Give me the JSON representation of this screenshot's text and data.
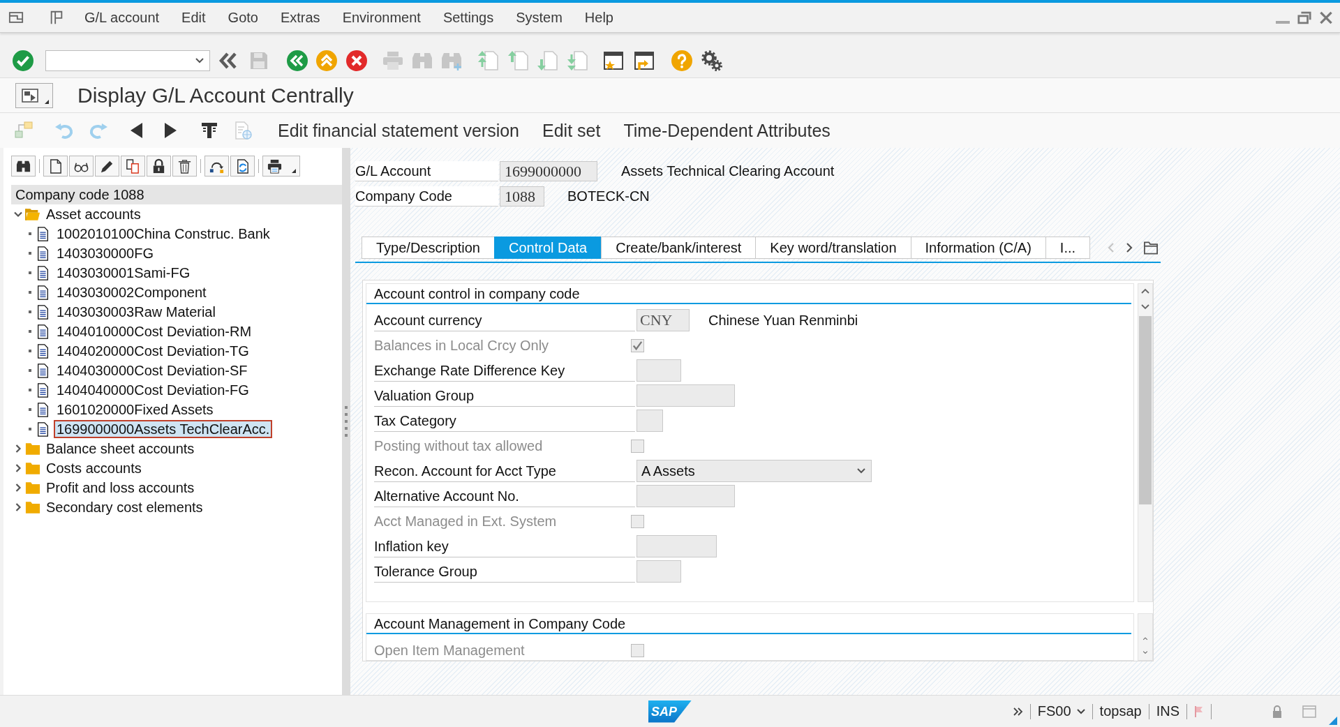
{
  "menu_bar": {
    "items": [
      "G/L account",
      "Edit",
      "Goto",
      "Extras",
      "Environment",
      "Settings",
      "System",
      "Help"
    ]
  },
  "title": "Display G/L Account Centrally",
  "app_toolbar": {
    "buttons": [
      "Edit financial statement version",
      "Edit set",
      "Time-Dependent Attributes"
    ]
  },
  "tree": {
    "header": "Company code 1088",
    "items": [
      {
        "label": "Asset accounts",
        "expanded": true,
        "selected": false,
        "children": [
          {
            "label": "1002010100China Construc. Bank",
            "selected": false
          },
          {
            "label": "1403030000FG",
            "selected": false
          },
          {
            "label": "1403030001Sami-FG",
            "selected": false
          },
          {
            "label": "1403030002Component",
            "selected": false
          },
          {
            "label": "1403030003Raw Material",
            "selected": false
          },
          {
            "label": "1404010000Cost Deviation-RM",
            "selected": false
          },
          {
            "label": "1404020000Cost Deviation-TG",
            "selected": false
          },
          {
            "label": "1404030000Cost Deviation-SF",
            "selected": false
          },
          {
            "label": "1404040000Cost Deviation-FG",
            "selected": false
          },
          {
            "label": "1601020000Fixed Assets",
            "selected": false
          },
          {
            "label": "1699000000Assets TechClearAcc.",
            "selected": true
          }
        ]
      },
      {
        "label": "Balance sheet accounts",
        "expanded": false,
        "selected": false
      },
      {
        "label": "Costs accounts",
        "expanded": false,
        "selected": false
      },
      {
        "label": "Profit and loss accounts",
        "expanded": false,
        "selected": false
      },
      {
        "label": "Secondary cost elements",
        "expanded": false,
        "selected": false
      }
    ]
  },
  "header_fields": [
    {
      "label": "G/L Account",
      "value": "1699000000",
      "description": "Assets Technical Clearing Account"
    },
    {
      "label": "Company Code",
      "value": "1088",
      "description": "BOTECK-CN"
    }
  ],
  "tabs": [
    {
      "label": "Type/Description",
      "selected": false
    },
    {
      "label": "Control Data",
      "selected": true
    },
    {
      "label": "Create/bank/interest",
      "selected": false
    },
    {
      "label": "Key word/translation",
      "selected": false
    },
    {
      "label": "Information (C/A)",
      "selected": false
    },
    {
      "label": "I...",
      "selected": false
    }
  ],
  "sections": [
    {
      "title": "Account control in company code",
      "fields": [
        {
          "kind": "text",
          "label": "Account currency",
          "value": "CNY",
          "description": "Chinese Yuan Renminbi",
          "disabled": false
        },
        {
          "kind": "checkbox",
          "label": "Balances in Local Crcy Only",
          "checked": true,
          "disabled": true
        },
        {
          "kind": "text",
          "label": "Exchange Rate Difference Key",
          "disabled": false
        },
        {
          "kind": "text",
          "label": "Valuation Group",
          "disabled": false
        },
        {
          "kind": "text",
          "label": "Tax Category",
          "disabled": false
        },
        {
          "kind": "checkbox",
          "label": "Posting without tax allowed",
          "checked": false,
          "disabled": true
        },
        {
          "kind": "dropdown",
          "label": "Recon. Account for Acct Type",
          "value": "A Assets",
          "disabled": false
        },
        {
          "kind": "text",
          "label": "Alternative Account No.",
          "disabled": false
        },
        {
          "kind": "checkbox",
          "label": "Acct Managed in Ext. System",
          "checked": false,
          "disabled": true
        },
        {
          "kind": "text",
          "label": "Inflation key",
          "disabled": false
        },
        {
          "kind": "text",
          "label": "Tolerance Group",
          "disabled": false
        }
      ]
    },
    {
      "title": "Account Management in Company Code",
      "fields": [
        {
          "kind": "checkbox",
          "label": "Open Item Management",
          "checked": false,
          "disabled": true
        }
      ]
    }
  ],
  "status_bar": {
    "logo": "SAP",
    "transaction": "FS00",
    "user": "topsap",
    "mode": "INS"
  }
}
